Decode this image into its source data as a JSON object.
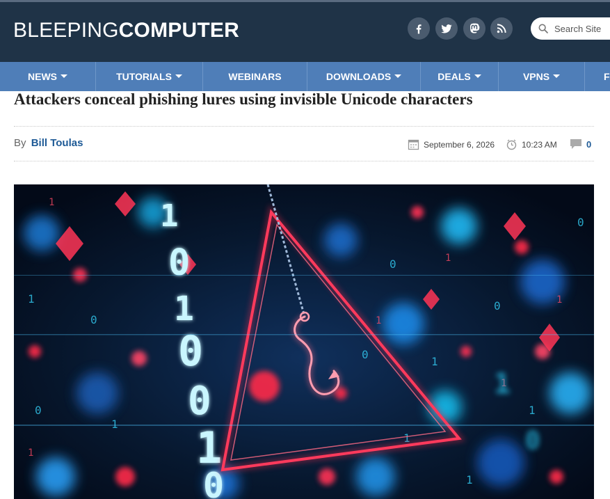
{
  "site": {
    "logo_light": "BLEEPING",
    "logo_bold": "COMPUTER"
  },
  "social": [
    "facebook-icon",
    "twitter-icon",
    "mastodon-icon",
    "rss-icon"
  ],
  "search": {
    "placeholder": "Search Site"
  },
  "nav": [
    {
      "label": "NEWS",
      "dropdown": true
    },
    {
      "label": "TUTORIALS",
      "dropdown": true
    },
    {
      "label": "WEBINARS",
      "dropdown": false
    },
    {
      "label": "DOWNLOADS",
      "dropdown": true
    },
    {
      "label": "DEALS",
      "dropdown": true
    },
    {
      "label": "VPNS",
      "dropdown": true
    },
    {
      "label": "F",
      "dropdown": false
    }
  ],
  "article": {
    "title": "Attackers conceal phishing lures using invisible Unicode characters",
    "by": "By",
    "author": "Bill Toulas",
    "date": "September 6, 2026",
    "time": "10:23 AM",
    "comments": "0",
    "hero_image": {
      "binary_digits": [
        "1",
        "0",
        "1",
        "0",
        "0",
        "1",
        "0",
        "1",
        "0"
      ],
      "accent_colors": {
        "neon_red": "#ff2b4a",
        "neon_cyan": "#2ad4ff"
      }
    }
  },
  "colors": {
    "header_bg": "#1f3347",
    "nav_bg": "#4f7eb8",
    "link": "#1e5a96"
  }
}
